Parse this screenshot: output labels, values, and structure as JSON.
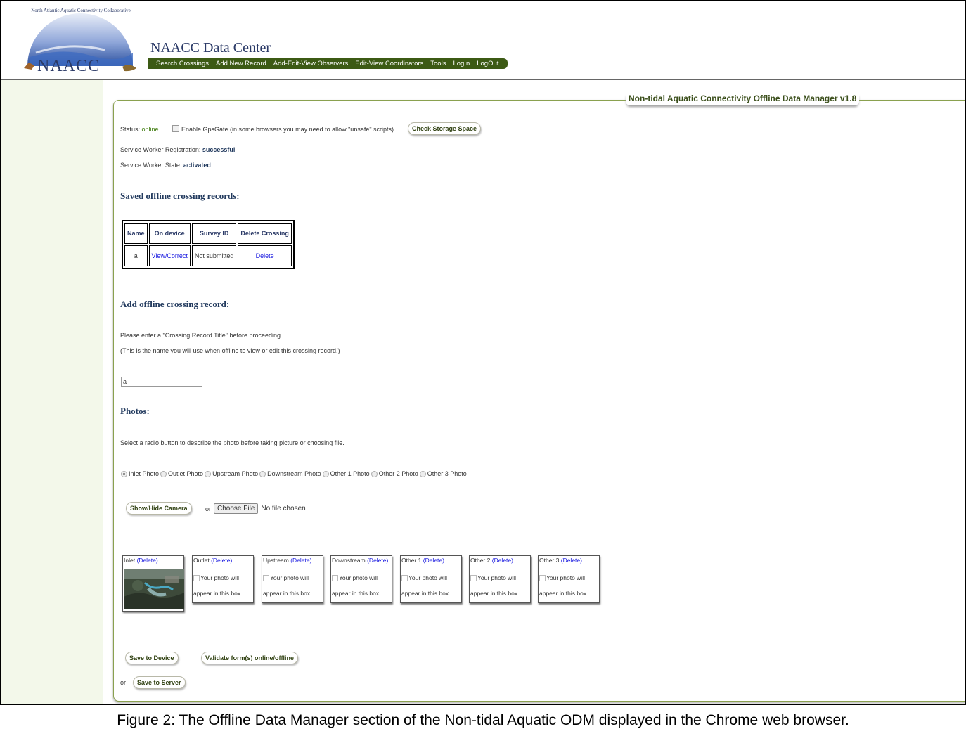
{
  "header": {
    "logo_arc_text": "North Atlantic Aquatic Connectivity Collaborative",
    "logo_text": "NAACC",
    "site_title": "NAACC Data Center",
    "nav": [
      "Search Crossings",
      "Add New Record",
      "Add-Edit-View Observers",
      "Edit-View Coordinators",
      "Tools",
      "LogIn",
      "LogOut"
    ]
  },
  "manager": {
    "legend": "Non-tidal Aquatic Connectivity Offline Data Manager v1.8",
    "status_label": "Status:",
    "status_value": "online",
    "gpsgate_label": "Enable GpsGate (in some browsers you may need to allow \"unsafe\" scripts)",
    "check_storage_button": "Check Storage Space",
    "sw_registration_label": "Service Worker Registration:",
    "sw_registration_value": "successful",
    "sw_state_label": "Service Worker State:",
    "sw_state_value": "activated"
  },
  "saved": {
    "heading": "Saved offline crossing records:",
    "columns": [
      "Name",
      "On device",
      "Survey ID",
      "Delete Crossing"
    ],
    "rows": [
      {
        "name": "a",
        "on_device": "View/Correct",
        "survey_id": "Not submitted",
        "delete": "Delete"
      }
    ]
  },
  "add": {
    "heading": "Add offline crossing record:",
    "instruction": "Please enter a \"Crossing Record Title\" before proceeding.",
    "note": "(This is the name you will use when offline to view or edit this crossing record.)",
    "title_value": "a"
  },
  "photos": {
    "heading": "Photos:",
    "instruction": "Select a radio button to describe the photo before taking picture or choosing file.",
    "radio_options": [
      "Inlet Photo",
      "Outlet Photo",
      "Upstream Photo",
      "Downstream Photo",
      "Other 1 Photo",
      "Other 2 Photo",
      "Other 3 Photo"
    ],
    "selected": "Inlet Photo",
    "camera_button": "Show/Hide Camera",
    "or": "or",
    "choose_file": "Choose File",
    "no_file": "No file chosen",
    "boxes": [
      {
        "label": "Inlet",
        "delete": "(Delete)"
      },
      {
        "label": "Outlet",
        "delete": "(Delete)"
      },
      {
        "label": "Upstream",
        "delete": "(Delete)"
      },
      {
        "label": "Downstream",
        "delete": "(Delete)"
      },
      {
        "label": "Other 1",
        "delete": "(Delete)"
      },
      {
        "label": "Other 2",
        "delete": "(Delete)"
      },
      {
        "label": "Other 3",
        "delete": "(Delete)"
      }
    ],
    "placeholder_line1": "Your photo will",
    "placeholder_line2": "appear in this box."
  },
  "actions": {
    "save_device": "Save to Device",
    "validate": "Validate form(s) online/offline",
    "or": "or",
    "save_server": "Save to Server"
  },
  "caption": "Figure 2: The Offline Data Manager section of the Non-tidal Aquatic ODM displayed in the Chrome web browser."
}
